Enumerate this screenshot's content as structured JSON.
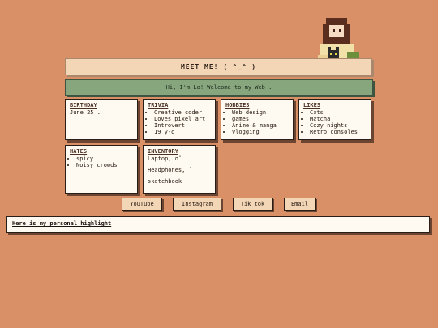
{
  "header": {
    "title": "MEET ME! ( ^_^ )"
  },
  "welcome": {
    "text": "Hi, I'm Lo! Welcome to my Web ."
  },
  "cards": {
    "birthday": {
      "heading": "BIRTHDAY",
      "value": "June 25 ."
    },
    "trivia": {
      "heading": "TRIVIA",
      "items": [
        "Creative coder",
        "Loves pixel art",
        "Introvert",
        "19 y-o"
      ]
    },
    "hobbies": {
      "heading": "HOBBIES",
      "items": [
        "Web design",
        "games",
        "Anime & manga",
        "vlogging"
      ]
    },
    "likes": {
      "heading": "LIKES",
      "items": [
        "Cats",
        "Matcha",
        "Cozy nights",
        "Retro consoles"
      ]
    },
    "hates": {
      "heading": "HATES",
      "items": [
        "spicy",
        "Noisy crowds"
      ]
    },
    "inventory": {
      "heading": "INVENTORY",
      "items": [
        "Laptop, ∩˘",
        "Headphones, ˙",
        "sketchbook"
      ]
    }
  },
  "links": {
    "youtube": "YouTube",
    "instagram": "Instagram",
    "tiktok": "Tik tok",
    "email": "Email"
  },
  "highlight": {
    "text": "Here is my personal highlight"
  },
  "colors": {
    "background": "#d99066",
    "card": "#fffaf1",
    "welcome_bar": "#87a67e",
    "title_bar": "#f3d6b6"
  }
}
